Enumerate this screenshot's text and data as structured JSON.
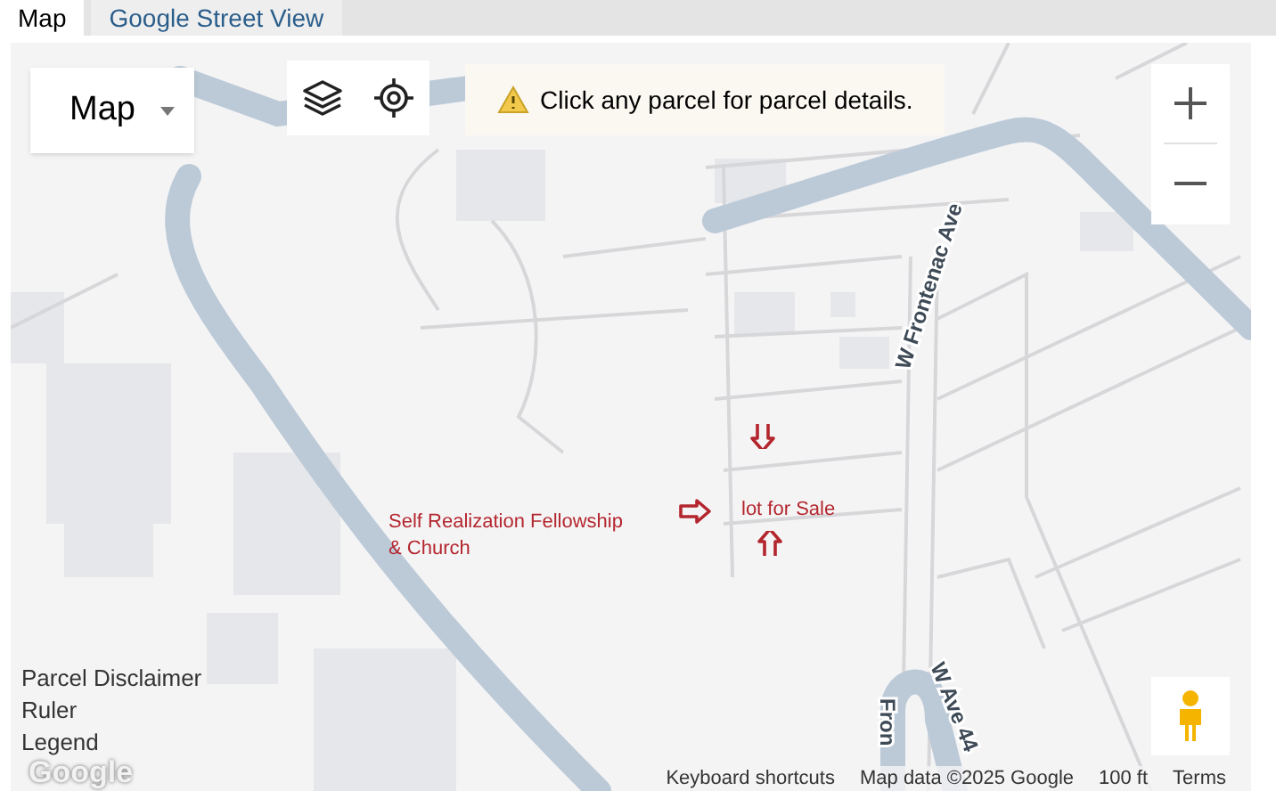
{
  "tabs": [
    {
      "label": "Map",
      "selected": true
    },
    {
      "label": "Google Street View",
      "selected": false
    }
  ],
  "map_type": {
    "label": "Map"
  },
  "notice": {
    "text": "Click any parcel for parcel details."
  },
  "street_labels": [
    "W Frontenac Ave",
    "W Ave 44",
    "Fron"
  ],
  "annotations": {
    "church": [
      "Self Realization Fellowship",
      "& Church"
    ],
    "lot": "lot for Sale"
  },
  "links": [
    "Parcel Disclaimer",
    "Ruler",
    "Legend"
  ],
  "logo": "Google",
  "footer": [
    "Keyboard shortcuts",
    "Map data ©2025 Google",
    "100 ft",
    "Terms"
  ]
}
